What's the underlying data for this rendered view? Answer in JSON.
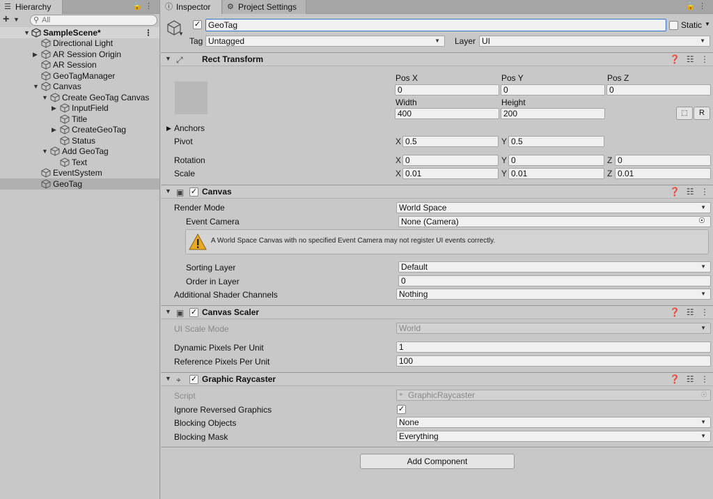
{
  "hierarchy": {
    "tab_label": "Hierarchy",
    "search_placeholder": "All",
    "scene_name": "SampleScene*",
    "items": [
      {
        "label": "Directional Light"
      },
      {
        "label": "AR Session Origin"
      },
      {
        "label": "AR Session"
      },
      {
        "label": "GeoTagManager"
      },
      {
        "label": "Canvas"
      },
      {
        "label": "Create GeoTag Canvas"
      },
      {
        "label": "InputField"
      },
      {
        "label": "Title"
      },
      {
        "label": "CreateGeoTag"
      },
      {
        "label": "Status"
      },
      {
        "label": "Add GeoTag"
      },
      {
        "label": "Text"
      },
      {
        "label": "EventSystem"
      },
      {
        "label": "GeoTag"
      }
    ]
  },
  "inspector": {
    "tab_label": "Inspector",
    "project_settings_label": "Project Settings",
    "object_name": "GeoTag",
    "static_label": "Static",
    "tag_label": "Tag",
    "tag_value": "Untagged",
    "layer_label": "Layer",
    "layer_value": "UI"
  },
  "rect_transform": {
    "title": "Rect Transform",
    "pos_x_label": "Pos X",
    "pos_y_label": "Pos Y",
    "pos_z_label": "Pos Z",
    "pos_x": "0",
    "pos_y": "0",
    "pos_z": "0",
    "width_label": "Width",
    "height_label": "Height",
    "width": "400",
    "height": "200",
    "r_button": "R",
    "anchors_label": "Anchors",
    "pivot_label": "Pivot",
    "pivot_x": "0.5",
    "pivot_y": "0.5",
    "rotation_label": "Rotation",
    "rot_x": "0",
    "rot_y": "0",
    "rot_z": "0",
    "scale_label": "Scale",
    "scale_x": "0.01",
    "scale_y": "0.01",
    "scale_z": "0.01",
    "axis_x": "X",
    "axis_y": "Y",
    "axis_z": "Z"
  },
  "canvas": {
    "title": "Canvas",
    "render_mode_label": "Render Mode",
    "render_mode": "World Space",
    "event_camera_label": "Event Camera",
    "event_camera": "None (Camera)",
    "warning_text": "A World Space Canvas with no specified Event Camera may not register UI events correctly.",
    "sorting_layer_label": "Sorting Layer",
    "sorting_layer": "Default",
    "order_in_layer_label": "Order in Layer",
    "order_in_layer": "0",
    "shader_channels_label": "Additional Shader Channels",
    "shader_channels": "Nothing"
  },
  "canvas_scaler": {
    "title": "Canvas Scaler",
    "ui_scale_mode_label": "UI Scale Mode",
    "ui_scale_mode": "World",
    "dynamic_ppu_label": "Dynamic Pixels Per Unit",
    "dynamic_ppu": "1",
    "reference_ppu_label": "Reference Pixels Per Unit",
    "reference_ppu": "100"
  },
  "graphic_raycaster": {
    "title": "Graphic Raycaster",
    "script_label": "Script",
    "script_value": "GraphicRaycaster",
    "ignore_reversed_label": "Ignore Reversed Graphics",
    "blocking_objects_label": "Blocking Objects",
    "blocking_objects": "None",
    "blocking_mask_label": "Blocking Mask",
    "blocking_mask": "Everything"
  },
  "add_component_label": "Add Component"
}
